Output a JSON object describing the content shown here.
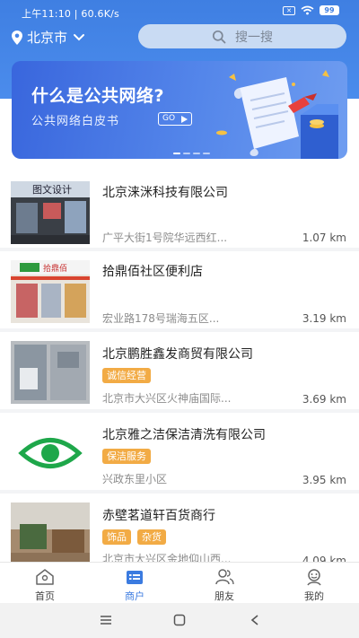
{
  "status_bar": {
    "time": "上午11:10 | 60.6K/s",
    "battery": "99"
  },
  "header": {
    "city": "北京市",
    "search_placeholder": "搜一搜"
  },
  "banner": {
    "title": "什么是公共网络?",
    "subtitle": "公共网络白皮书",
    "go_label": "GO"
  },
  "shops": [
    {
      "name": "北京涞洣科技有限公司",
      "tags": [],
      "address": "广平大街1号院华远西红...",
      "distance": "1.07 km",
      "thumb_text": "图文设计"
    },
    {
      "name": "拾鼎佰社区便利店",
      "tags": [],
      "address": "宏业路178号瑞海五区...",
      "distance": "3.19 km",
      "thumb_text": "拾鼎佰"
    },
    {
      "name": "北京鹏胜鑫发商贸有限公司",
      "tags": [
        "诚信经营"
      ],
      "address": "北京市大兴区火神庙国际...",
      "distance": "3.69 km"
    },
    {
      "name": "北京雅之洁保洁清洗有限公司",
      "tags": [
        "保洁服务"
      ],
      "address": "兴政东里小区",
      "distance": "3.95 km"
    },
    {
      "name": "赤壁茗道轩百货商行",
      "tags": [
        "饰品",
        "杂货"
      ],
      "address": "北京市大兴区金地仰山西...",
      "distance": "4.09 km"
    }
  ],
  "tabbar": [
    {
      "label": "首页",
      "icon": "home-icon"
    },
    {
      "label": "商户",
      "icon": "merchant-icon"
    },
    {
      "label": "朋友",
      "icon": "friends-icon"
    },
    {
      "label": "我的",
      "icon": "profile-icon"
    }
  ],
  "colors": {
    "primary": "#3b7be0",
    "tag": "#f2ab45",
    "eye_green": "#1ea74a"
  }
}
